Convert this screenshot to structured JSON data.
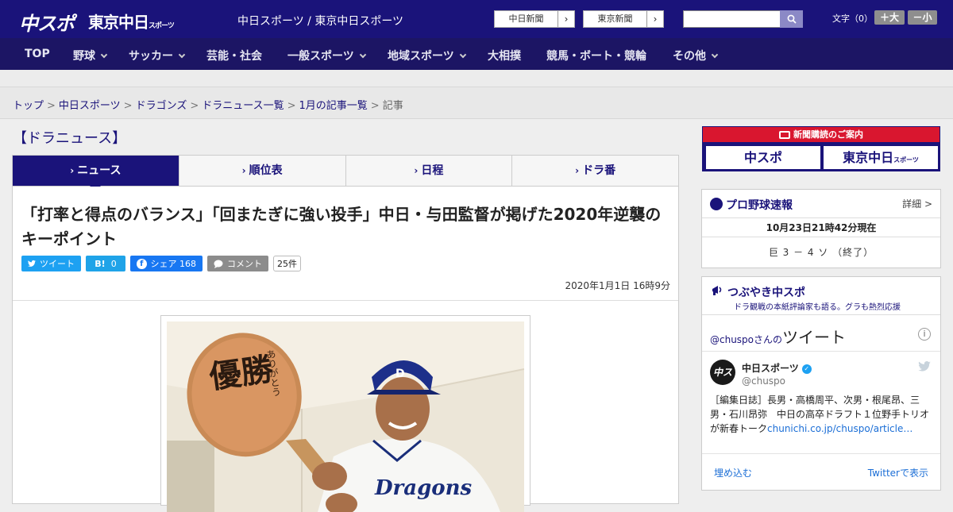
{
  "header": {
    "logo_main": "中スポ",
    "logo_tokyo": "東京中日",
    "logo_tokyo_small": "スポーツ",
    "site_title": "中日スポーツ / 東京中日スポーツ",
    "paper_links": [
      {
        "label": "中日新聞",
        "arrow": "›"
      },
      {
        "label": "東京新聞",
        "arrow": "›"
      }
    ],
    "search": {
      "value": "",
      "placeholder": ""
    },
    "font_size_label": "文字（0）",
    "font_bigger": "＋大",
    "font_smaller": "－小"
  },
  "nav": {
    "items": [
      {
        "label": "TOP",
        "has_menu": false
      },
      {
        "label": "野球",
        "has_menu": true
      },
      {
        "label": "サッカー",
        "has_menu": true
      },
      {
        "label": "芸能・社会",
        "has_menu": false
      },
      {
        "label": "一般スポーツ",
        "has_menu": true
      },
      {
        "label": "地域スポーツ",
        "has_menu": true
      },
      {
        "label": "大相撲",
        "has_menu": false
      },
      {
        "label": "競馬・ボート・競輪",
        "has_menu": false
      },
      {
        "label": "その他",
        "has_menu": true
      }
    ]
  },
  "breadcrumb": {
    "items": [
      "トップ",
      "中日スポーツ",
      "ドラゴンズ",
      "ドラニュース一覧",
      "1月の記事一覧"
    ],
    "current": "記事",
    "separator": ">"
  },
  "section": {
    "title": "【ドラニュース】"
  },
  "tabs": [
    {
      "label": "ニュース",
      "active": true
    },
    {
      "label": "順位表",
      "active": false
    },
    {
      "label": "日程",
      "active": false
    },
    {
      "label": "ドラ番",
      "active": false
    }
  ],
  "article": {
    "headline": "「打率と得点のバランス」「回またぎに強い投手」中日・与田監督が掲げた2020年逆襲のキーポイント",
    "share": {
      "tweet_label": "ツイート",
      "hatena_label": "B!",
      "hatena_count": "0",
      "facebook_label": "シェア",
      "facebook_count": "168",
      "comment_label": "コメント",
      "comment_count": "25件"
    },
    "date": "2020年1月1日 16時9分",
    "photo": {
      "mallet_text": "優勝",
      "mallet_sub": "ありがとう",
      "uniform_text": "Dragons"
    }
  },
  "sidebar": {
    "subscription": {
      "banner": "新聞購読のご案内",
      "logo1": "中スポ",
      "logo2": "東京中日",
      "logo2_small": "スポーツ"
    },
    "baseball": {
      "title": "プロ野球速報",
      "more": "詳細 >",
      "updated": "10月23日21時42分現在",
      "score": "巨 3 － 4 ソ （終了）"
    },
    "twitter": {
      "title": "つぶやき中スポ",
      "subtitle": "ドラ観戦の本紙評論家も語る。グラも熱烈応援",
      "caption_handle": "@chuspo",
      "caption_suffix": "さんの",
      "caption_big": "ツイート",
      "info_icon": "i",
      "account_name": "中日スポーツ",
      "account_handle": "@chuspo",
      "avatar_text": "中スポ",
      "tweet_text": "［編集日誌］長男・高橋周平、次男・根尾昂、三男・石川昂弥　中日の高卒ドラフト１位野手トリオが新春トーク",
      "tweet_link": "chunichi.co.jp/chuspo/article…",
      "embed_label": "埋め込む",
      "view_label": "Twitterで表示"
    }
  },
  "colors": {
    "brand_navy": "#1a137a",
    "nav_navy": "#1c1564",
    "subscription_red": "#d9162f",
    "twitter_blue": "#1da1f2",
    "facebook_blue": "#1877f2"
  }
}
